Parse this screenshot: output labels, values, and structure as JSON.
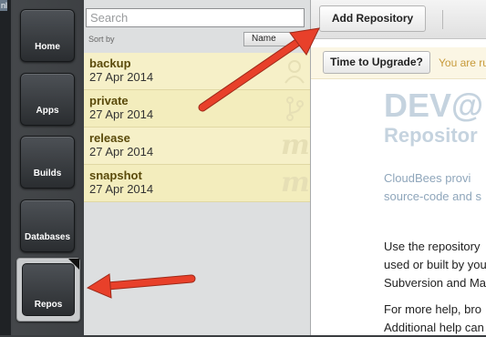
{
  "nav": {
    "items": [
      {
        "label": "Home"
      },
      {
        "label": "Apps"
      },
      {
        "label": "Builds"
      },
      {
        "label": "Databases"
      },
      {
        "label": "Repos",
        "active": true
      }
    ],
    "edge_text": "nl"
  },
  "list": {
    "search_placeholder": "Search",
    "sort_by_label": "Sort by",
    "sort_value": "Name",
    "repos": [
      {
        "name": "backup",
        "date": "27 Apr 2014",
        "icon": "avatar-icon"
      },
      {
        "name": "private",
        "date": "27 Apr 2014",
        "icon": "git-branch-icon"
      },
      {
        "name": "release",
        "date": "27 Apr 2014",
        "icon": "maven-icon"
      },
      {
        "name": "snapshot",
        "date": "27 Apr 2014",
        "icon": "maven-icon"
      }
    ]
  },
  "content": {
    "add_repository_label": "Add Repository",
    "upgrade_button_label": "Time to Upgrade?",
    "upgrade_text": "You are ru",
    "title": "DEV@",
    "subtitle": "Repositor",
    "intro_lines": [
      "CloudBees provi",
      "source-code and s"
    ],
    "usage_lines": [
      "Use the repository",
      "used or built by you",
      "Subversion and Mav"
    ],
    "help_lines": [
      "For more help, bro",
      "Additional help can"
    ]
  },
  "colors": {
    "annotation_arrow": "#e8402a",
    "repo_row": "#f6f0c8",
    "title_color": "#c5d3df"
  }
}
